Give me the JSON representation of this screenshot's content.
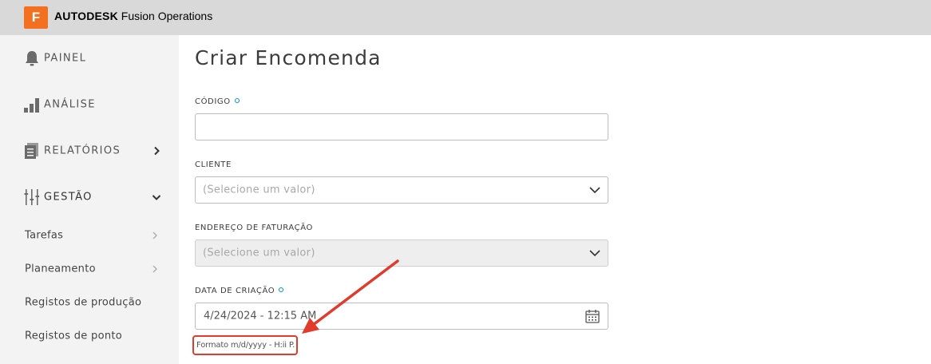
{
  "header": {
    "logo_letter": "F",
    "brand_bold": "AUTODESK",
    "brand_rest": " Fusion Operations",
    "logo_color": "#f37021"
  },
  "sidebar": {
    "items": [
      {
        "label": "PAINEL",
        "icon": "bell-icon"
      },
      {
        "label": "ANÁLISE",
        "icon": "bar-chart-icon"
      },
      {
        "label": "RELATÓRIOS",
        "icon": "reports-icon",
        "chevron": "chevron-right-icon"
      },
      {
        "label": "GESTÃO",
        "icon": "sliders-icon",
        "chevron": "chevron-down-icon"
      }
    ],
    "subitems": [
      {
        "label": "Tarefas",
        "chevron": true
      },
      {
        "label": "Planeamento",
        "chevron": true
      },
      {
        "label": "Registos de produção",
        "chevron": false
      },
      {
        "label": "Registos de ponto",
        "chevron": false
      }
    ]
  },
  "form": {
    "title": "Criar Encomenda",
    "codigo": {
      "label": "CÓDIGO",
      "value": ""
    },
    "cliente": {
      "label": "CLIENTE",
      "placeholder": "(Selecione um valor)"
    },
    "endereco": {
      "label": "ENDEREÇO DE FATURAÇÃO",
      "placeholder": "(Selecione um valor)"
    },
    "data": {
      "label": "DATA DE CRIAÇÃO",
      "value": "4/24/2024 - 12:15 AM",
      "hint": "Formato m/d/yyyy - H:ii P."
    }
  },
  "colors": {
    "accent": "#0696d7",
    "annotation": "#e03b2c"
  }
}
